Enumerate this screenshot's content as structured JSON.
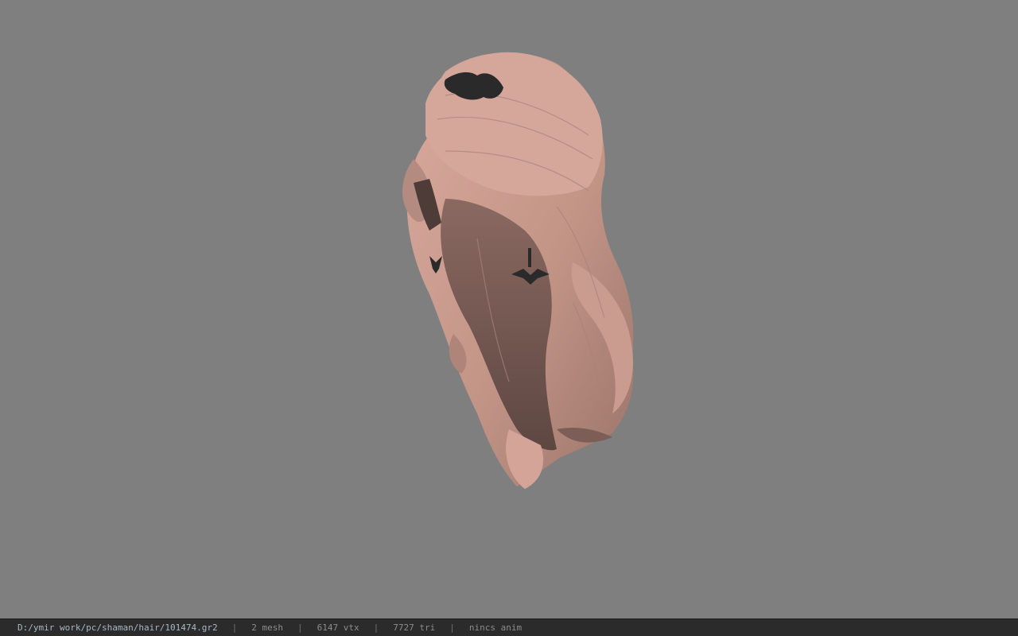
{
  "viewport": {
    "background": "#7f7f7f",
    "model_icon": "hair-model-icon"
  },
  "statusbar": {
    "file_path": "D:/ymir work/pc/shaman/hair/101474.gr2",
    "separator": "|",
    "mesh": "2 mesh",
    "vtx": "6147 vtx",
    "tri": "7727 tri",
    "anim": "nincs anim"
  },
  "colors": {
    "hair_light": "#d7a598",
    "hair_mid": "#b58a7f",
    "hair_dark": "#6e534d",
    "accessory": "#2a2a2a",
    "statusbar_bg": "#2b2b2b",
    "path_text": "#a9b7c6"
  }
}
